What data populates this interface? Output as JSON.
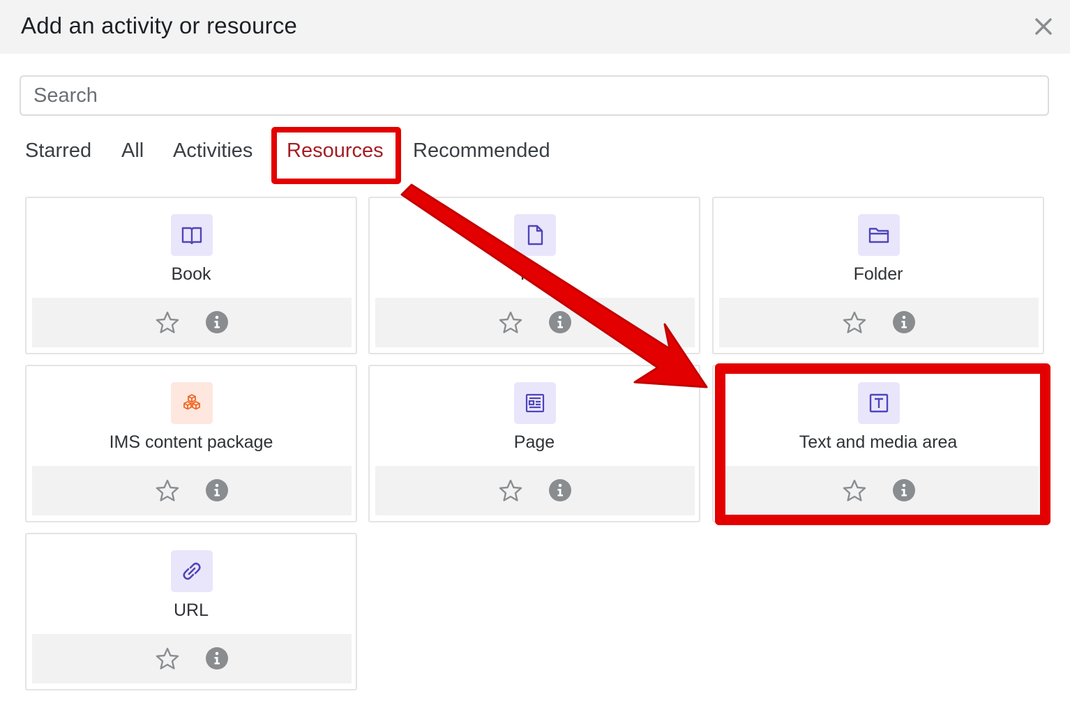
{
  "dialog": {
    "title": "Add an activity or resource",
    "close_icon": "close-icon"
  },
  "search": {
    "placeholder": "Search",
    "value": ""
  },
  "tabs": [
    {
      "label": "Starred",
      "active": false
    },
    {
      "label": "All",
      "active": false
    },
    {
      "label": "Activities",
      "active": false
    },
    {
      "label": "Resources",
      "active": true
    },
    {
      "label": "Recommended",
      "active": false
    }
  ],
  "items": [
    {
      "label": "Book",
      "icon": "book-icon"
    },
    {
      "label": "File",
      "icon": "file-icon"
    },
    {
      "label": "Folder",
      "icon": "folder-icon"
    },
    {
      "label": "IMS content package",
      "icon": "package-icon"
    },
    {
      "label": "Page",
      "icon": "page-icon"
    },
    {
      "label": "Text and media area",
      "icon": "text-area-icon"
    },
    {
      "label": "URL",
      "icon": "link-icon"
    }
  ],
  "colors": {
    "accent_tab": "#a61d24",
    "annotation_red": "#e30000",
    "icon_purple": "#4f45b8",
    "icon_orange": "#f06520",
    "icon_bg_purple": "#e9e6fb",
    "icon_bg_orange": "#fde7df"
  }
}
